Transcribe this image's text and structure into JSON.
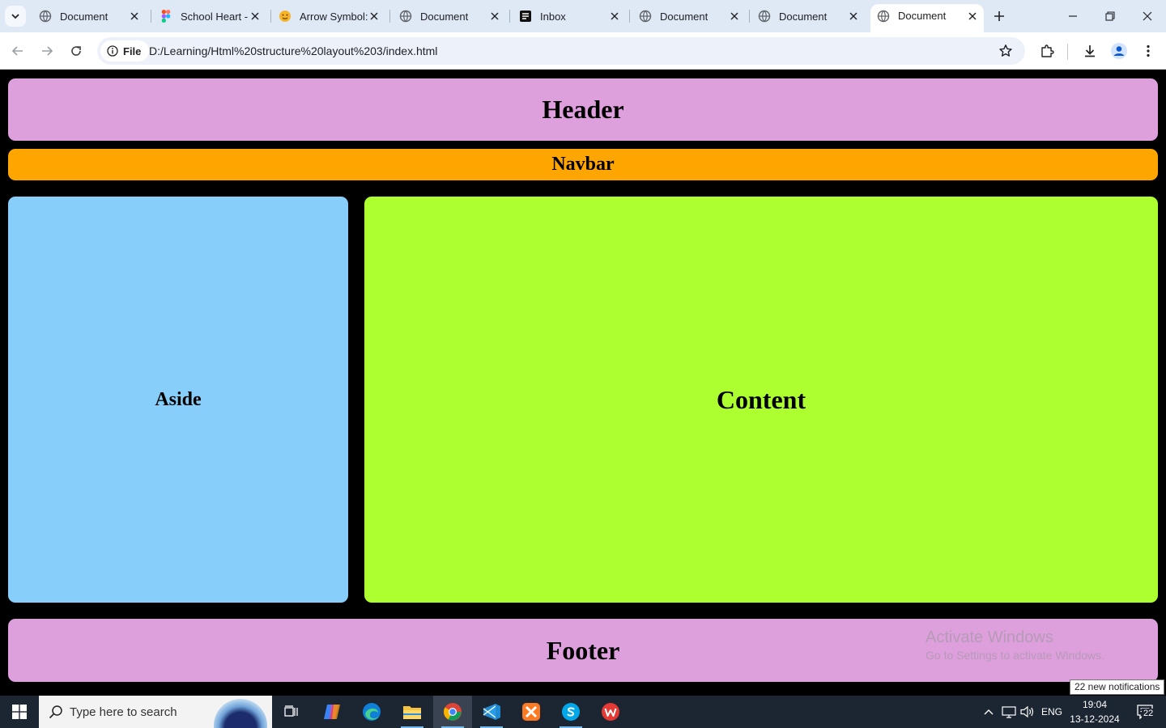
{
  "browser": {
    "tabs": [
      {
        "title": "Document",
        "favicon": "globe-icon",
        "active": false
      },
      {
        "title": "School Heart -",
        "favicon": "figma-icon",
        "active": false
      },
      {
        "title": "Arrow Symbol:",
        "favicon": "emoji-icon",
        "active": false
      },
      {
        "title": "Document",
        "favicon": "globe-icon",
        "active": false
      },
      {
        "title": "Inbox",
        "favicon": "inbox-icon",
        "active": false
      },
      {
        "title": "Document",
        "favicon": "globe-icon",
        "active": false
      },
      {
        "title": "Document",
        "favicon": "globe-icon",
        "active": false
      },
      {
        "title": "Document",
        "favicon": "globe-icon",
        "active": true
      }
    ],
    "site_chip_label": "File",
    "url": "D:/Learning/Html%20structure%20layout%203/index.html"
  },
  "page": {
    "header": "Header",
    "navbar": "Navbar",
    "aside": "Aside",
    "content": "Content",
    "footer": "Footer",
    "colors": {
      "header": "#dda0dd",
      "navbar": "#ffa500",
      "aside": "#87cefa",
      "content": "#adff2f",
      "footer": "#dda0dd",
      "background": "#000000"
    }
  },
  "watermark": {
    "line1": "Activate Windows",
    "line2": "Go to Settings to activate Windows."
  },
  "notification_tooltip": "22 new notifications",
  "taskbar": {
    "search_placeholder": "Type here to search",
    "apps": [
      "task-view-icon",
      "copilot-icon",
      "edge-icon",
      "file-explorer-icon",
      "chrome-icon",
      "vscode-icon",
      "xampp-icon",
      "skype-icon",
      "wps-office-icon"
    ],
    "language": "ENG",
    "time": "19:04",
    "date": "13-12-2024",
    "notification_count": "22"
  }
}
